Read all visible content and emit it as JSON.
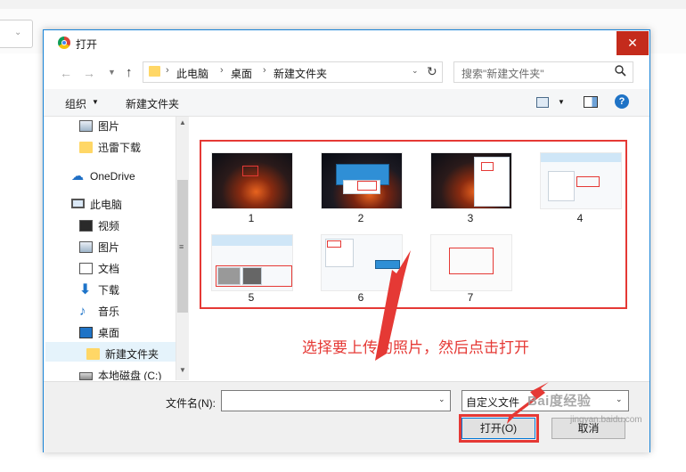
{
  "dialog": {
    "title": "打开",
    "close_symbol": "✕"
  },
  "address": {
    "crumbs": [
      "此电脑",
      "桌面",
      "新建文件夹"
    ],
    "search_placeholder": "搜索\"新建文件夹\""
  },
  "toolbar": {
    "organize_label": "组织",
    "new_folder_label": "新建文件夹",
    "help_label": "?"
  },
  "nav": {
    "items": [
      {
        "label": "图片",
        "icon": "picture-icon"
      },
      {
        "label": "迅雷下载",
        "icon": "folder-icon"
      },
      {
        "label": "OneDrive",
        "icon": "cloud-icon"
      },
      {
        "label": "此电脑",
        "icon": "computer-icon"
      },
      {
        "label": "视频",
        "icon": "video-icon"
      },
      {
        "label": "图片",
        "icon": "picture-icon"
      },
      {
        "label": "文档",
        "icon": "document-icon"
      },
      {
        "label": "下载",
        "icon": "download-icon"
      },
      {
        "label": "音乐",
        "icon": "music-icon"
      },
      {
        "label": "桌面",
        "icon": "desktop-icon"
      },
      {
        "label": "新建文件夹",
        "icon": "folder-icon",
        "selected": true
      },
      {
        "label": "本地磁盘 (C:)",
        "icon": "disk-icon"
      }
    ]
  },
  "files": [
    {
      "name": "1"
    },
    {
      "name": "2"
    },
    {
      "name": "3"
    },
    {
      "name": "4"
    },
    {
      "name": "5"
    },
    {
      "name": "6"
    },
    {
      "name": "7"
    }
  ],
  "annotation": "选择要上传的照片，然后点击打开",
  "bottom": {
    "filename_label": "文件名(N):",
    "filename_value": "",
    "filetype_value": "自定义文件",
    "open_label": "打开(O)",
    "cancel_label": "取消"
  },
  "watermark": {
    "text": "Bai度经验",
    "url": "jingyan.baidu.com"
  },
  "colors": {
    "accent": "#1883d7",
    "annotation_red": "#e53935",
    "close_red": "#c42b1c"
  }
}
